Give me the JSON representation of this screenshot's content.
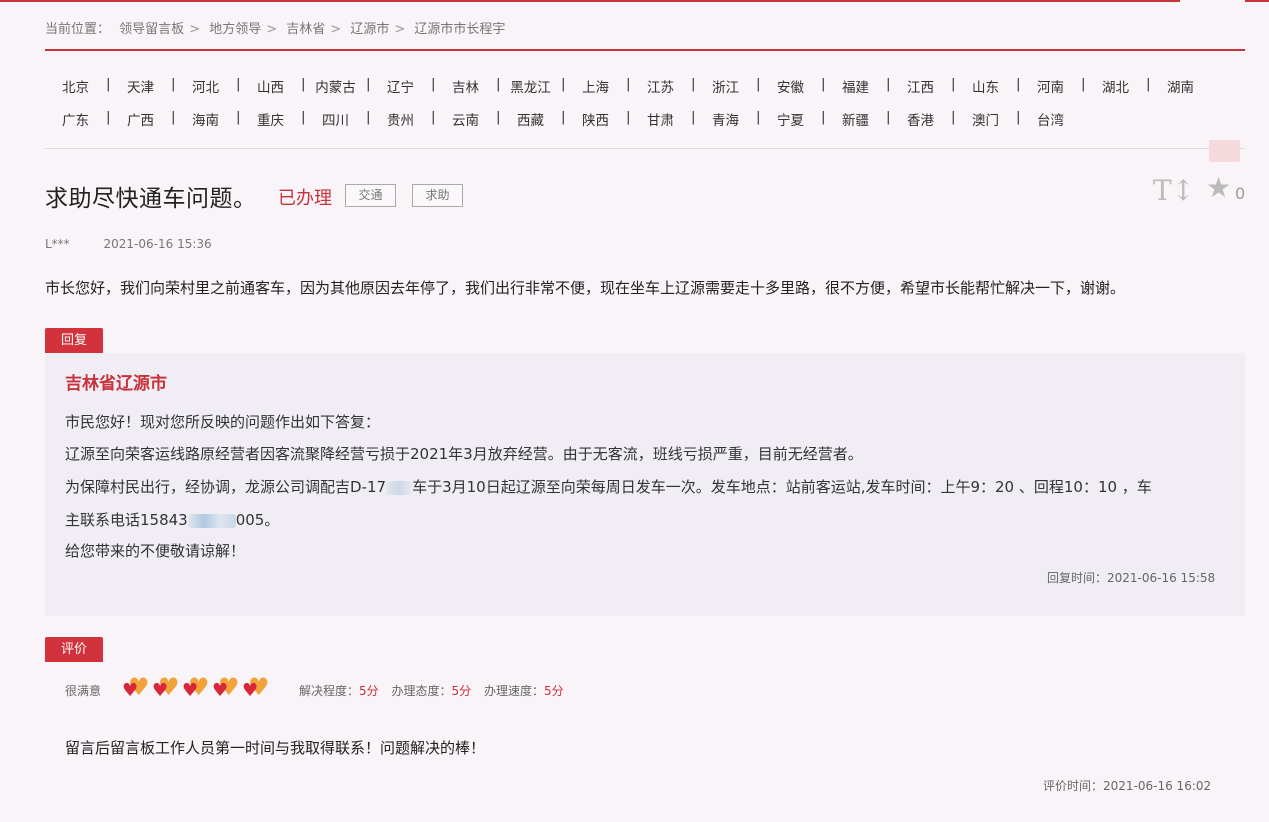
{
  "breadcrumb": {
    "prefix": "当前位置：",
    "items": [
      "领导留言板",
      "地方领导",
      "吉林省",
      "辽源市",
      "辽源市市长程宇"
    ],
    "separator": ">"
  },
  "provinces": {
    "row1": [
      "北京",
      "天津",
      "河北",
      "山西",
      "内蒙古",
      "辽宁",
      "吉林",
      "黑龙江",
      "上海",
      "江苏",
      "浙江",
      "安徽",
      "福建",
      "江西",
      "山东",
      "河南",
      "湖北",
      "湖南"
    ],
    "row2": [
      "广东",
      "广西",
      "海南",
      "重庆",
      "四川",
      "贵州",
      "云南",
      "西藏",
      "陕西",
      "甘肃",
      "青海",
      "宁夏",
      "新疆",
      "香港",
      "澳门",
      "台湾"
    ],
    "separator": "|"
  },
  "message": {
    "title": "求助尽快通车问题。",
    "status": "已办理",
    "tags": [
      "交通",
      "求助"
    ],
    "author": "L***",
    "date": "2021-06-16 15:36",
    "content": "市长您好，我们向荣村里之前通客车，因为其他原因去年停了，我们出行非常不便，现在坐车上辽源需要走十多里路，很不方便，希望市长能帮忙解决一下，谢谢。",
    "font_toggle_label": "T↕",
    "star_count": "0"
  },
  "reply": {
    "label": "回复",
    "org": "吉林省辽源市",
    "line1": "市民您好！现对您所反映的问题作出如下答复：",
    "line2": "辽源至向荣客运线路原经营者因客流聚降经营亏损于2021年3月放弃经营。由于无客流，班线亏损严重，目前无经营者。",
    "line3_a": "为保障村民出行，经协调，龙源公司调配吉D-17",
    "line3_b": "车于3月10日起辽源至向荣每周日发车一次。发车地点：站前客运站,发车时间：上午9：20 、回程10：10 ，车",
    "line4_a": "主联系电话15843",
    "line4_b": "005。",
    "line5": "给您带来的不便敬请谅解！",
    "time": "回复时间：2021-06-16 15:58"
  },
  "evaluation": {
    "label": "评价",
    "level": "很满意",
    "hearts": 5,
    "scores": [
      {
        "name": "解决程度：",
        "value": "5分"
      },
      {
        "name": "办理态度：",
        "value": "5分"
      },
      {
        "name": "办理速度：",
        "value": "5分"
      }
    ],
    "text": "留言后留言板工作人员第一时间与我取得联系！问题解决的棒！",
    "time": "评价时间：2021-06-16 16:02"
  },
  "colors": {
    "accent": "#c8323c",
    "heart_back": "#f2a23a",
    "heart_front": "#d8263a",
    "reply_bg": "#f0eef4"
  }
}
